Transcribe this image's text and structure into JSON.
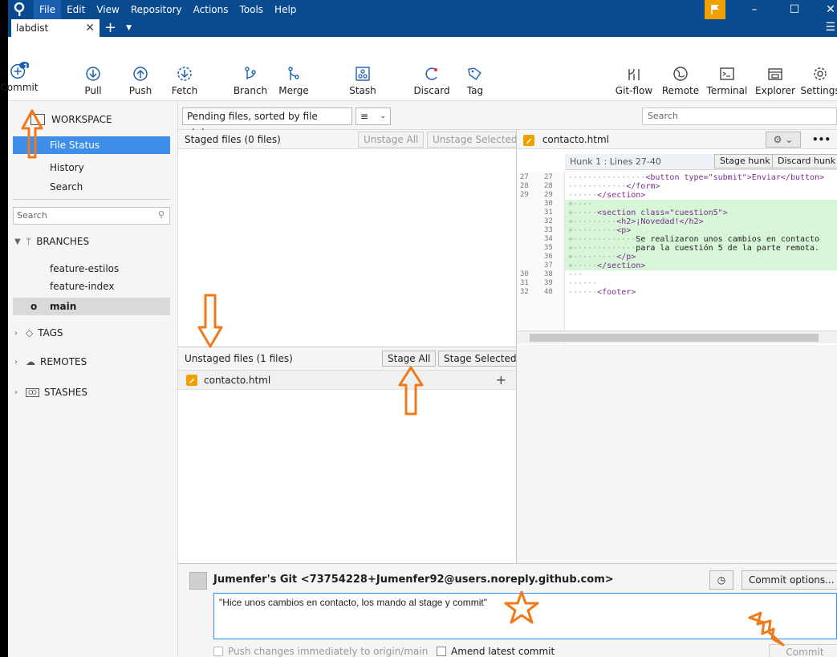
{
  "app": {
    "menu": [
      "File",
      "Edit",
      "View",
      "Repository",
      "Actions",
      "Tools",
      "Help"
    ],
    "repo_tab": "labdist"
  },
  "toolbar": {
    "commit": "Commit",
    "commit_badge": "1",
    "pull": "Pull",
    "push": "Push",
    "fetch": "Fetch",
    "branch": "Branch",
    "merge": "Merge",
    "stash": "Stash",
    "discard": "Discard",
    "tag": "Tag",
    "gitflow": "Git-flow",
    "remote": "Remote",
    "terminal": "Terminal",
    "explorer": "Explorer",
    "settings": "Settings"
  },
  "sidebar": {
    "workspace": "WORKSPACE",
    "file_status": "File Status",
    "history": "History",
    "search": "Search",
    "search_placeholder": "Search",
    "branches": "BRANCHES",
    "branch_items": [
      "feature-estilos",
      "feature-index",
      "main"
    ],
    "tags": "TAGS",
    "remotes": "REMOTES",
    "stashes": "STASHES"
  },
  "files": {
    "sort_label": "Pending files, sorted by file status",
    "search_placeholder": "Search",
    "staged_title": "Staged files  (0 files)",
    "unstage_all": "Unstage All",
    "unstage_selected": "Unstage Selected",
    "unstaged_title": "Unstaged files  (1 files)",
    "stage_all": "Stage All",
    "stage_selected": "Stage Selected",
    "unstaged_items": [
      "contacto.html"
    ]
  },
  "diff": {
    "filename": "contacto.html",
    "hunk_label": "Hunk 1 : Lines 27-40",
    "stage_hunk": "Stage hunk",
    "discard_hunk": "Discard hunk",
    "lines": [
      {
        "old": "27",
        "new": "27",
        "text": "<button type=\"submit\">Enviar</button>",
        "type": "ctx"
      },
      {
        "old": "28",
        "new": "28",
        "text": "</form>",
        "type": "ctx"
      },
      {
        "old": "29",
        "new": "29",
        "text": "</section>",
        "type": "ctx"
      },
      {
        "old": "",
        "new": "30",
        "text": "",
        "type": "add"
      },
      {
        "old": "",
        "new": "31",
        "text": "<section class=\"cuestion5\">",
        "type": "add"
      },
      {
        "old": "",
        "new": "32",
        "text": "<h2>¡Novedad!</h2>",
        "type": "add"
      },
      {
        "old": "",
        "new": "33",
        "text": "<p>",
        "type": "add"
      },
      {
        "old": "",
        "new": "34",
        "text": "Se realizaron unos cambios en contacto",
        "type": "add"
      },
      {
        "old": "",
        "new": "35",
        "text": "para la cuestión 5 de la parte remota.",
        "type": "add"
      },
      {
        "old": "",
        "new": "36",
        "text": "</p>",
        "type": "add"
      },
      {
        "old": "",
        "new": "37",
        "text": "</section>",
        "type": "add"
      },
      {
        "old": "30",
        "new": "38",
        "text": "",
        "type": "ctx"
      },
      {
        "old": "31",
        "new": "39",
        "text": "",
        "type": "ctx"
      },
      {
        "old": "32",
        "new": "40",
        "text": "<footer>",
        "type": "ctx"
      }
    ]
  },
  "commit": {
    "author": "Jumenfer's Git <73754228+Jumenfer92@users.noreply.github.com>",
    "message": "\"Hice unos cambios en contacto, los mando al stage y commit\"",
    "options": "Commit options...",
    "push_label": "Push changes immediately to origin/main",
    "amend_label": "Amend latest commit",
    "commit_button": "Commit"
  },
  "colors": {
    "titlebar": "#0a4a8f",
    "selection": "#3d8ee8",
    "annotation": "#f07a1a",
    "diff_added": "#d7f5d7"
  }
}
